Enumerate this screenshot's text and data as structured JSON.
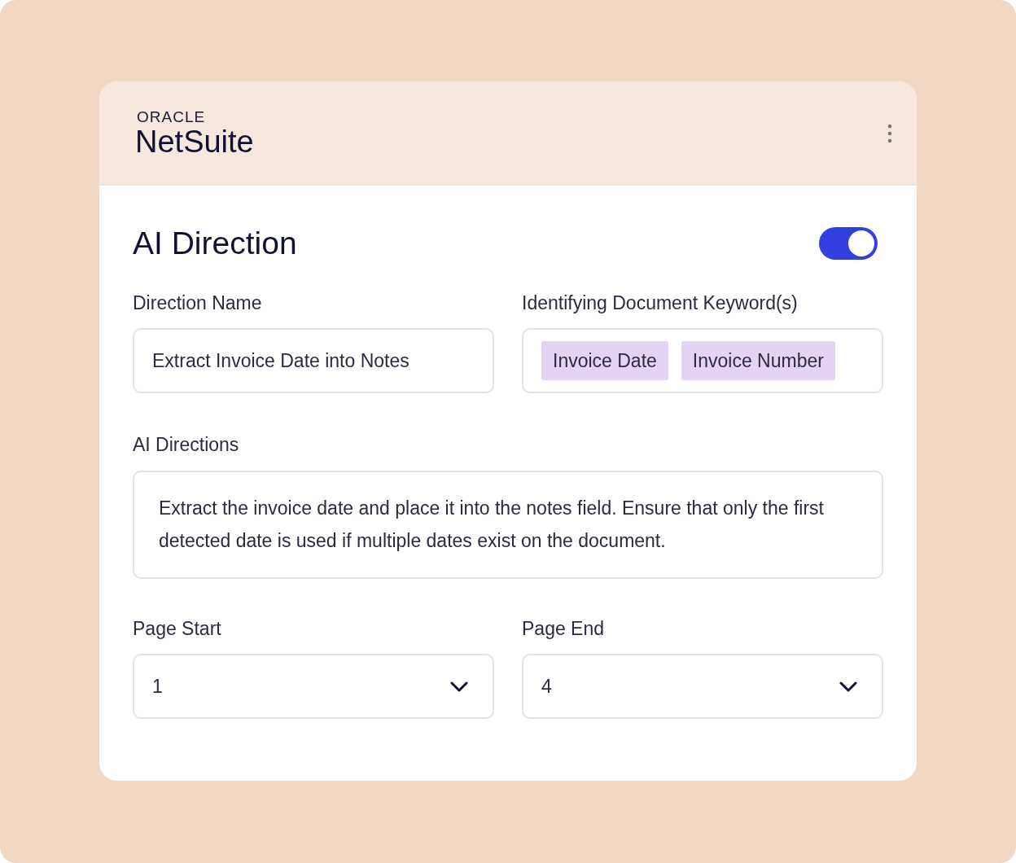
{
  "header": {
    "brand": "ORACLE",
    "product": "NetSuite"
  },
  "title": "AI Direction",
  "toggle": {
    "on": true
  },
  "direction_name": {
    "label": "Direction Name",
    "value": "Extract Invoice Date into Notes"
  },
  "keywords": {
    "label": "Identifying Document Keyword(s)",
    "tags": [
      "Invoice Date",
      "Invoice Number"
    ]
  },
  "ai_directions": {
    "label": "AI Directions",
    "value": "Extract the invoice date and place it into the notes field. Ensure that only the first detected date is used if multiple dates exist on the document."
  },
  "page_start": {
    "label": "Page Start",
    "value": "1"
  },
  "page_end": {
    "label": "Page End",
    "value": "4"
  }
}
